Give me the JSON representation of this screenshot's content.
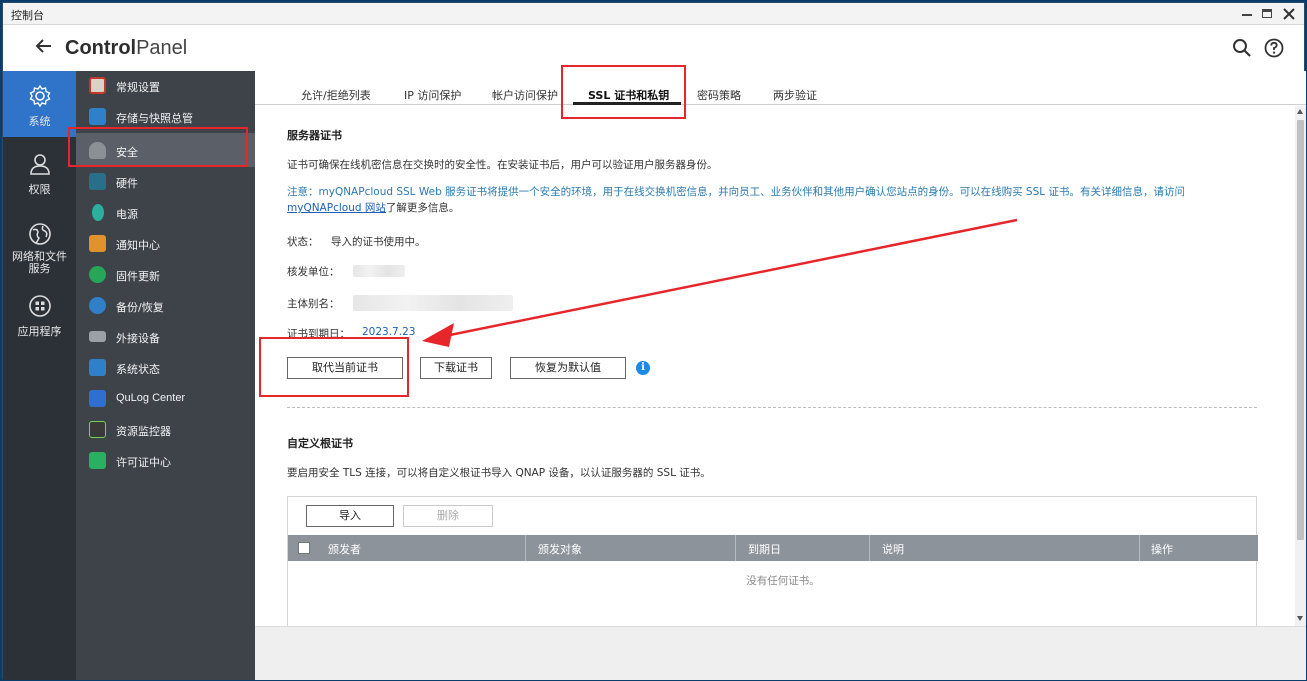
{
  "window": {
    "title": "控制台"
  },
  "header": {
    "app_title_bold": "Control",
    "app_title_light": "Panel"
  },
  "rail": {
    "items": [
      {
        "label": "系统",
        "icon": "gear-icon",
        "active": true
      },
      {
        "label": "权限",
        "icon": "user-icon",
        "active": false
      },
      {
        "label": "网络和文件服务",
        "icon": "globe-icon",
        "active": false
      },
      {
        "label": "应用程序",
        "icon": "apps-icon",
        "active": false
      }
    ]
  },
  "sidebar": {
    "items": [
      {
        "label": "常规设置",
        "icon": "general-settings-icon",
        "color": "#c0392b"
      },
      {
        "label": "存储与快照总管",
        "icon": "storage-icon",
        "color": "#2f80c8"
      },
      {
        "label": "安全",
        "icon": "security-icon",
        "color": "#8b8f96",
        "selected": true
      },
      {
        "label": "硬件",
        "icon": "hardware-icon",
        "color": "#2a6f8a"
      },
      {
        "label": "电源",
        "icon": "power-icon",
        "color": "#2bb0a0"
      },
      {
        "label": "通知中心",
        "icon": "notification-icon",
        "color": "#e0932a"
      },
      {
        "label": "固件更新",
        "icon": "firmware-icon",
        "color": "#27a65a"
      },
      {
        "label": "备份/恢复",
        "icon": "backup-icon",
        "color": "#2f80c8"
      },
      {
        "label": "外接设备",
        "icon": "external-device-icon",
        "color": "#9aa0a6"
      },
      {
        "label": "系统状态",
        "icon": "system-status-icon",
        "color": "#2f80c8"
      },
      {
        "label": "QuLog Center",
        "icon": "qulog-icon",
        "color": "#2f6fd0"
      },
      {
        "label": "资源监控器",
        "icon": "resource-monitor-icon",
        "color": "#3a3a3a"
      },
      {
        "label": "许可证中心",
        "icon": "license-icon",
        "color": "#2bb061"
      }
    ]
  },
  "tabs": [
    {
      "label": "允许/拒绝列表"
    },
    {
      "label": "IP 访问保护"
    },
    {
      "label": "帐户访问保护"
    },
    {
      "label": "SSL 证书和私钥",
      "active": true
    },
    {
      "label": "密码策略"
    },
    {
      "label": "两步验证"
    }
  ],
  "server_cert": {
    "title": "服务器证书",
    "description": "证书可确保在线机密信息在交换时的安全性。在安装证书后，用户可以验证用户服务器身份。",
    "note_text": "注意：myQNAPcloud SSL Web 服务证书将提供一个安全的环境，用于在线交换机密信息，并向员工、业务伙伴和其他用户确认您站点的身份。可以在线购买 SSL 证书。有关详细信息，请访问",
    "note_link": "myQNAPcloud 网站",
    "note_suffix": "了解更多信息。",
    "status_label": "状态：",
    "status_value": "导入的证书使用中。",
    "issuer_label": "核发单位：",
    "subject_label": "主体别名：",
    "expiry_label": "证书到期日：",
    "expiry_value": "2023.7.23",
    "buttons": {
      "replace": "取代当前证书",
      "download": "下载证书",
      "restore": "恢复为默认值"
    },
    "info_icon": "i"
  },
  "root_cert": {
    "title": "自定义根证书",
    "description": "要启用安全 TLS 连接，可以将自定义根证书导入 QNAP 设备，以认证服务器的 SSL 证书。",
    "import_label": "导入",
    "delete_label": "删除",
    "columns": [
      "颁发者",
      "颁发对象",
      "到期日",
      "说明",
      "操作"
    ],
    "empty_text": "没有任何证书。"
  },
  "colors": {
    "accent": "#2f74c9",
    "annotation_red": "#e6262a",
    "note_blue": "#2a7ab0"
  }
}
